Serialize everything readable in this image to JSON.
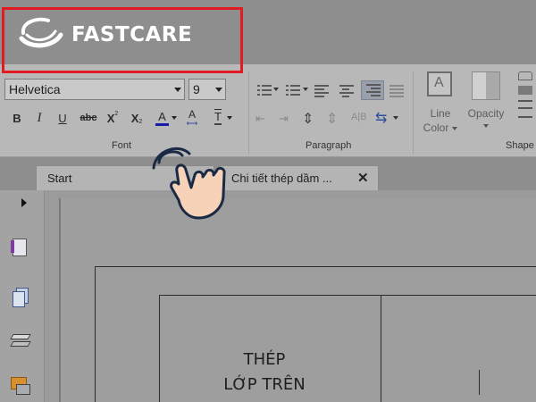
{
  "brand": {
    "name": "FASTCARE",
    "logo_icon": "swoosh-logo-icon",
    "color": "#ffffff"
  },
  "ribbon": {
    "font_group": {
      "label": "Font",
      "font_family": "Helvetica",
      "font_size": "9",
      "highlight_color": "#e01b22",
      "buttons": {
        "bold": "B",
        "italic": "I",
        "underline": "U",
        "strikethrough": "abc",
        "superscript": "X",
        "subscript": "X",
        "font_color": "A",
        "char_spacing": "A",
        "text_baseline": "T"
      }
    },
    "paragraph_group": {
      "label": "Paragraph",
      "align_label": "A|B"
    },
    "line_color": {
      "line1": "Line",
      "line2": "Color"
    },
    "opacity": {
      "label": "Opacity"
    },
    "shape_group": {
      "label": "Shape"
    }
  },
  "tabs": [
    {
      "label": "Start"
    },
    {
      "label": "Chi tiết thép dầm ..."
    }
  ],
  "tab_close": "✕",
  "document": {
    "line1": "THÉP",
    "line2": "LỚP TRÊN"
  },
  "icons": {
    "bullets": "bullet-list-icon",
    "numbering": "numbered-list-icon",
    "pointer": "tap-hand-icon"
  }
}
